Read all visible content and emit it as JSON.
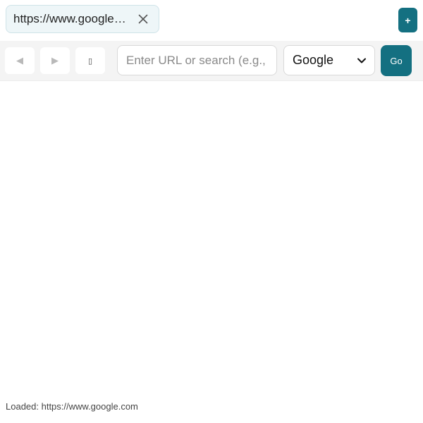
{
  "tabs": [
    {
      "title": "https://www.google.com",
      "close_icon": "close-icon"
    }
  ],
  "new_tab": {
    "label": "+"
  },
  "nav": {
    "back_glyph": "◀",
    "forward_glyph": "▶",
    "reload_glyph": "▯"
  },
  "address_bar": {
    "value": "",
    "placeholder": "Enter URL or search (e.g., example.com)"
  },
  "search_engine": {
    "selected": "Google",
    "options": [
      "Google"
    ]
  },
  "go_button": {
    "label": "Go"
  },
  "status": {
    "text": "Loaded: https://www.google.com"
  },
  "colors": {
    "accent": "#147081",
    "tab_background": "#eef6f8",
    "toolbar_background": "#f4f4f4"
  }
}
